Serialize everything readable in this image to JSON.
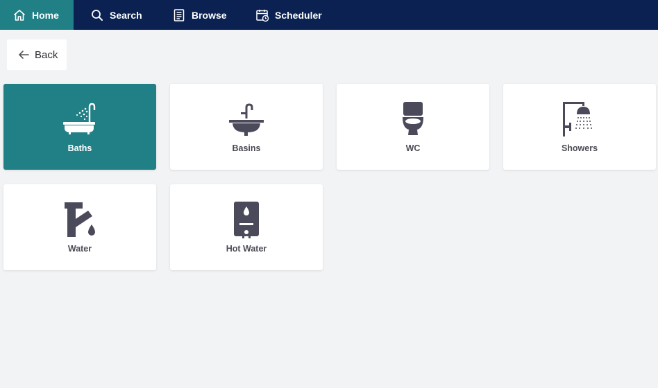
{
  "nav": {
    "items": [
      {
        "label": "Home",
        "icon": "home-icon",
        "active": true
      },
      {
        "label": "Search",
        "icon": "search-icon",
        "active": false
      },
      {
        "label": "Browse",
        "icon": "browse-list-icon",
        "active": false
      },
      {
        "label": "Scheduler",
        "icon": "calendar-clock-icon",
        "active": false
      }
    ]
  },
  "back": {
    "label": "Back",
    "icon": "arrow-left-icon"
  },
  "tiles": [
    {
      "label": "Baths",
      "icon": "bath-icon",
      "active": true
    },
    {
      "label": "Basins",
      "icon": "basin-icon",
      "active": false
    },
    {
      "label": "WC",
      "icon": "toilet-icon",
      "active": false
    },
    {
      "label": "Showers",
      "icon": "shower-icon",
      "active": false
    },
    {
      "label": "Water",
      "icon": "tap-water-icon",
      "active": false
    },
    {
      "label": "Hot Water",
      "icon": "water-heater-icon",
      "active": false
    }
  ],
  "colors": {
    "topbar": "#0b2151",
    "accent": "#217f86",
    "background": "#f2f3f5",
    "tile": "#ffffff",
    "icon": "#4b4a5a"
  }
}
